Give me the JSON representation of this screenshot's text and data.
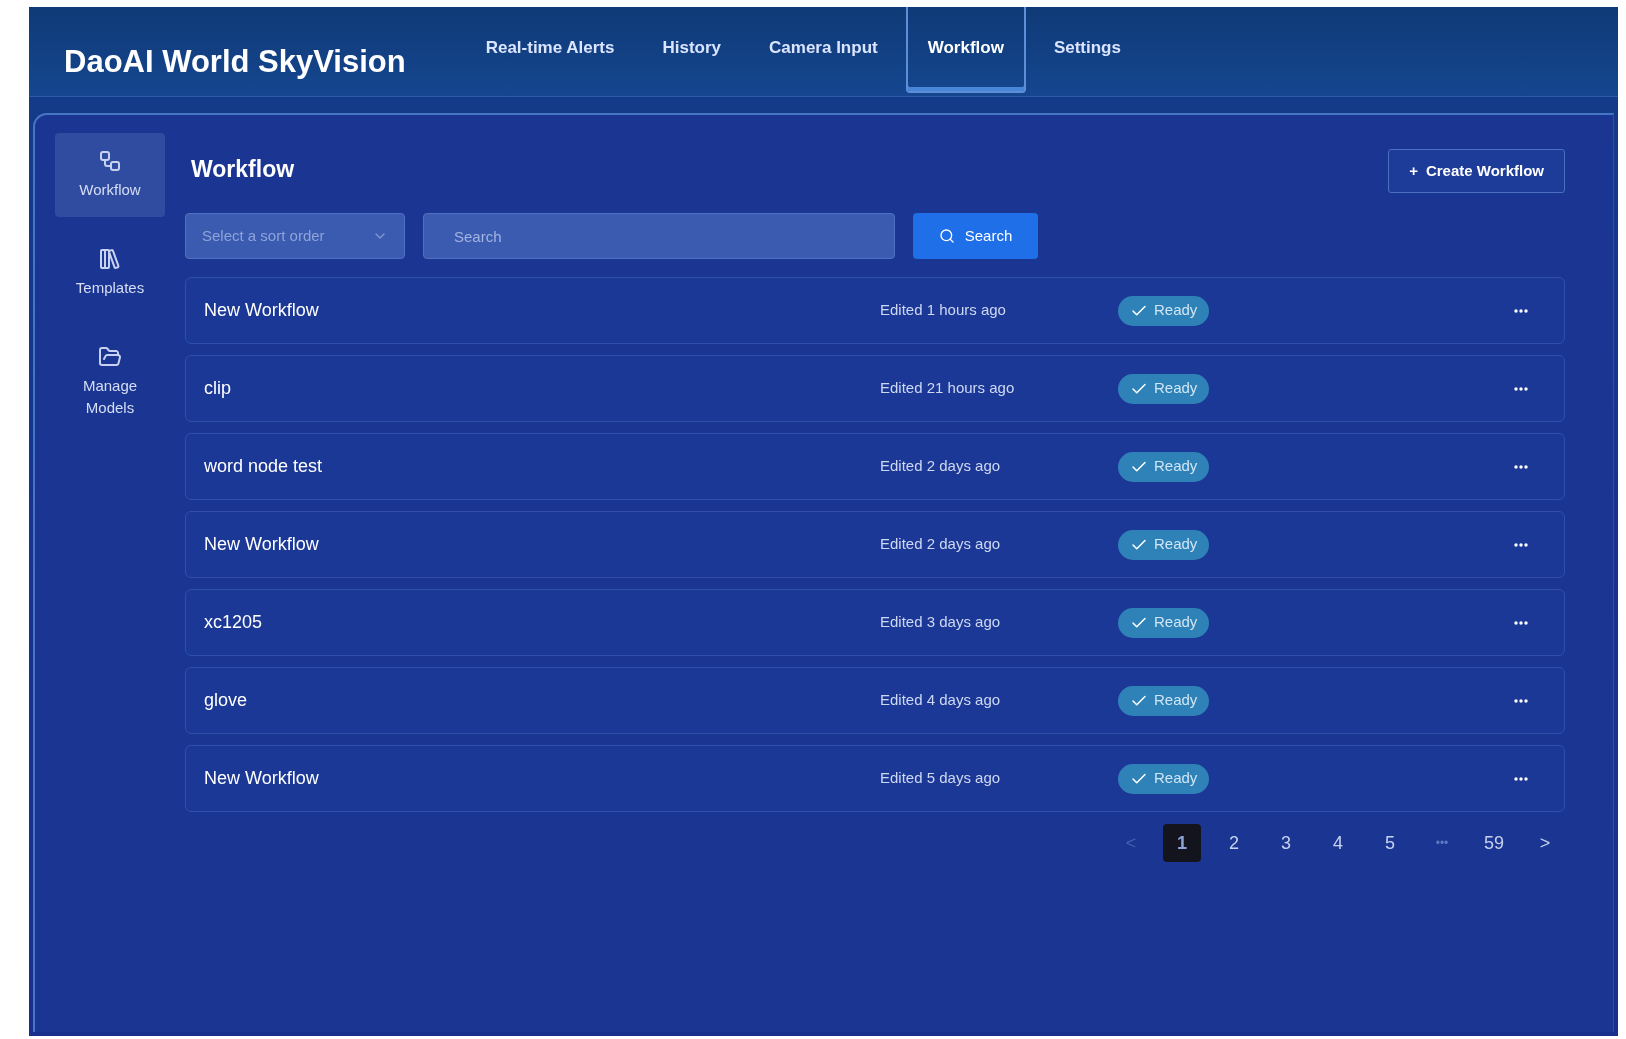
{
  "app_title": "DaoAI World SkyVision",
  "nav": [
    {
      "label": "Real-time Alerts",
      "selected": false
    },
    {
      "label": "History",
      "selected": false
    },
    {
      "label": "Camera Input",
      "selected": false
    },
    {
      "label": "Workflow",
      "selected": true
    },
    {
      "label": "Settings",
      "selected": false
    }
  ],
  "sidebar": {
    "items": [
      {
        "label": "Workflow",
        "selected": true
      },
      {
        "label": "Templates",
        "selected": false
      },
      {
        "label": "Manage Models",
        "selected": false
      }
    ]
  },
  "page_title": "Workflow",
  "create_button": {
    "icon": "+",
    "label": "Create Workflow"
  },
  "sort_select": {
    "placeholder": "Select a sort order"
  },
  "search": {
    "placeholder": "Search",
    "button": "Search"
  },
  "workflows": [
    {
      "name": "New Workflow",
      "edited": "Edited 1 hours ago",
      "status": "Ready"
    },
    {
      "name": "clip",
      "edited": "Edited 21 hours ago",
      "status": "Ready"
    },
    {
      "name": "word node test",
      "edited": "Edited 2 days ago",
      "status": "Ready"
    },
    {
      "name": "New Workflow",
      "edited": "Edited 2 days ago",
      "status": "Ready"
    },
    {
      "name": "xc1205",
      "edited": "Edited 3 days ago",
      "status": "Ready"
    },
    {
      "name": "glove",
      "edited": "Edited 4 days ago",
      "status": "Ready"
    },
    {
      "name": "New Workflow",
      "edited": "Edited 5 days ago",
      "status": "Ready"
    }
  ],
  "pagination": {
    "prev": {
      "label": "<",
      "disabled": true
    },
    "pages": [
      {
        "label": "1",
        "kind": "page",
        "selected": true
      },
      {
        "label": "2",
        "kind": "page",
        "selected": false
      },
      {
        "label": "3",
        "kind": "page",
        "selected": false
      },
      {
        "label": "4",
        "kind": "page",
        "selected": false
      },
      {
        "label": "5",
        "kind": "page",
        "selected": false
      },
      {
        "label": "•••",
        "kind": "ellipsis"
      },
      {
        "label": "59",
        "kind": "page",
        "selected": false
      }
    ],
    "next": {
      "label": ">",
      "disabled": false
    }
  }
}
